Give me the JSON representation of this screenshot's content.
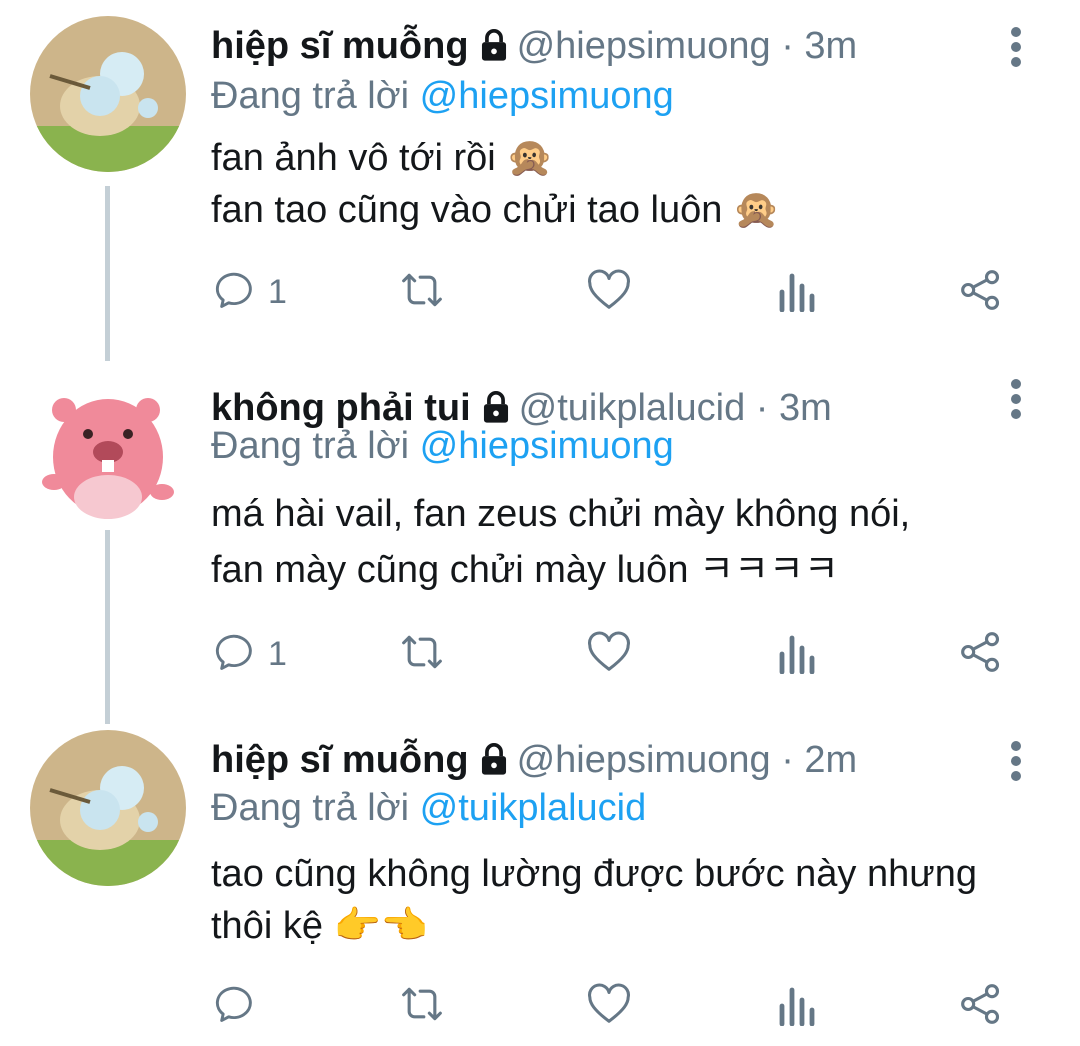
{
  "tweets": [
    {
      "name": "hiệp sĩ muỗng",
      "handle": "@hiepsimuong",
      "dot": "·",
      "time": "3m",
      "reply_prefix": "Đang trả lời",
      "reply_to": "@hiepsimuong",
      "lines": [
        "fan ảnh vô tới rồi 🙊",
        "fan tao cũng vào chửi tao luôn 🙊"
      ],
      "reply_count": "1"
    },
    {
      "name": "không phải tui",
      "handle": "@tuikplalucid",
      "dot": "·",
      "time": "3m",
      "reply_prefix": "Đang trả lời",
      "reply_to": "@hiepsimuong",
      "lines": [
        "má hài vail, fan zeus chửi mày không nói,",
        "fan mày cũng chửi mày luôn ㅋㅋㅋㅋ"
      ],
      "reply_count": "1"
    },
    {
      "name": "hiệp sĩ muỗng",
      "handle": "@hiepsimuong",
      "dot": "·",
      "time": "2m",
      "reply_prefix": "Đang trả lời",
      "reply_to": "@tuikplalucid",
      "lines": [
        "tao cũng không lường được bước này nhưng",
        "thôi kệ 👉👈"
      ],
      "reply_count": ""
    }
  ],
  "icons": {
    "lock": "lock-icon",
    "more": "more-vertical-icon",
    "reply": "reply-icon",
    "retweet": "retweet-icon",
    "like": "heart-icon",
    "analytics": "analytics-icon",
    "share": "share-icon"
  },
  "colors": {
    "text": "#14171a",
    "secondary": "#657786",
    "link": "#1da1f2",
    "thread_line": "#c4cfd6"
  }
}
